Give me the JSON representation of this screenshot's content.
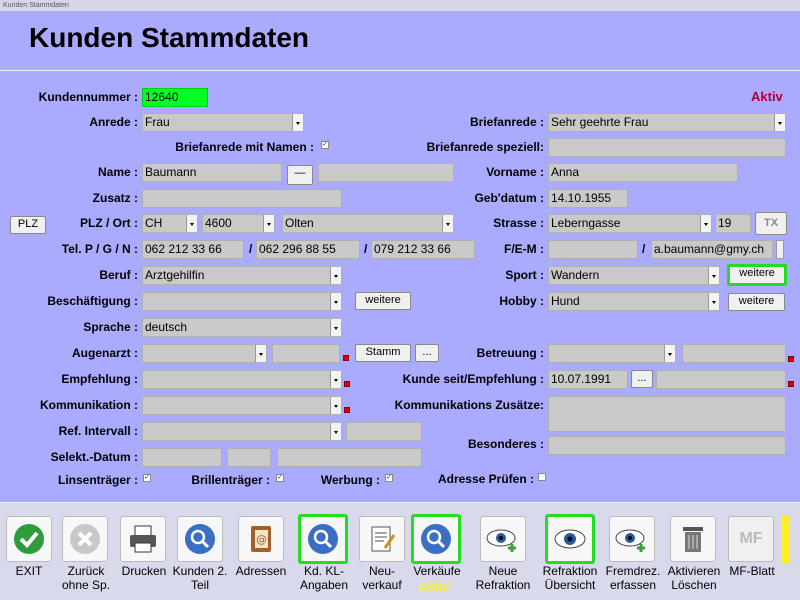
{
  "window_title": "Kunden Stammdaten",
  "page_title": "Kunden Stammdaten",
  "status": "Aktiv",
  "labels": {
    "kundennummer": "Kundennummer :",
    "anrede": "Anrede :",
    "briefanrede_namen": "Briefanrede mit Namen :",
    "name": "Name :",
    "zusatz": "Zusatz :",
    "plz_ort": "PLZ / Ort :",
    "tel": "Tel. P / G / N :",
    "beruf": "Beruf :",
    "beschaeftigung": "Beschäftigung :",
    "sprache": "Sprache :",
    "augenarzt": "Augenarzt :",
    "empfehlung": "Empfehlung :",
    "kommunikation": "Kommunikation :",
    "ref_intervall": "Ref. Intervall :",
    "selekt_datum": "Selekt.-Datum :",
    "linsentraeger": "Linsenträger :",
    "brillentraeger": "Brillenträger :",
    "werbung": "Werbung :",
    "adresse_pruefen": "Adresse Prüfen :",
    "briefanrede": "Briefanrede :",
    "briefanrede_speziell": "Briefanrede speziell:",
    "vorname": "Vorname :",
    "gebdatum": "Geb'datum :",
    "strasse": "Strasse :",
    "fem": "F/E-M :",
    "sport": "Sport :",
    "hobby": "Hobby :",
    "betreuung": "Betreuung :",
    "kunde_seit": "Kunde seit/Empfehlung :",
    "komm_zusaetze": "Kommunikations Zusätze:",
    "besonderes": "Besonderes :"
  },
  "values": {
    "kundennummer": "12640",
    "anrede": "Frau",
    "name": "Baumann",
    "plz_country": "CH",
    "plz": "4600",
    "ort": "Olten",
    "tel_p": "062 212 33 66",
    "tel_g": "062 296 88 55",
    "tel_n": "079 212 33 66",
    "beruf": "Arztgehilfin",
    "sprache": "deutsch",
    "briefanrede": "Sehr geehrte Frau",
    "vorname": "Anna",
    "gebdatum": "14.10.1955",
    "strasse": "Leberngasse",
    "hausnummer": "19",
    "email": "a.baumann@gmy.ch",
    "sport": "Wandern",
    "hobby": "Hund",
    "kunde_seit": "10.07.1991",
    "sep_slash": "/"
  },
  "buttons": {
    "plz": "PLZ",
    "name_dash": "—",
    "tx": "TX",
    "weitere": "weitere",
    "stamm": "Stamm",
    "dots": "..."
  },
  "toolbar": {
    "items": [
      {
        "label": "EXIT",
        "icon": "check-icon"
      },
      {
        "label": "Zurück ohne Sp.",
        "icon": "cancel-icon"
      },
      {
        "label": "Drucken",
        "icon": "printer-icon"
      },
      {
        "label": "Kunden 2. Teil",
        "icon": "search-icon"
      },
      {
        "label": "Adressen",
        "icon": "address-book-icon"
      },
      {
        "label": "Kd. KL-Angaben",
        "icon": "search-icon"
      },
      {
        "label": "Neu-verkauf",
        "icon": "notepad-icon"
      },
      {
        "label": "Verkäufe",
        "icon": "search-icon"
      },
      {
        "label": "Neue Refraktion",
        "icon": "eye-plus-icon"
      },
      {
        "label": "Refraktion Übersicht",
        "icon": "eye-icon"
      },
      {
        "label": "Fremdrez. erfassen",
        "icon": "eye-plus-icon"
      },
      {
        "label": "Aktivieren Löschen",
        "icon": "trash-icon"
      },
      {
        "label": "MF-Blatt",
        "icon": "mf-icon"
      }
    ],
    "verkaeufe_status": "Aktiv",
    "mf_text": "MF"
  },
  "colors": {
    "background": "#aaaaff",
    "accent_green": "#22dd22",
    "status_red": "#b00030",
    "aktiv_yellow": "#ffee33"
  }
}
